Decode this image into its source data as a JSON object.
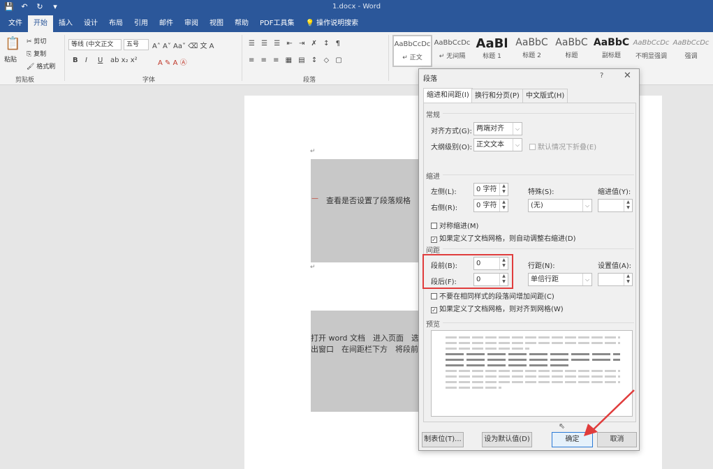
{
  "app": {
    "title": "1.docx - Word"
  },
  "qat": [
    {
      "icon": "save-icon",
      "glyph": "💾"
    },
    {
      "icon": "undo-icon",
      "glyph": "↶"
    },
    {
      "icon": "redo-icon",
      "glyph": "↻"
    },
    {
      "icon": "customize-icon",
      "glyph": "▾"
    }
  ],
  "tabs": [
    "文件",
    "开始",
    "插入",
    "设计",
    "布局",
    "引用",
    "邮件",
    "审阅",
    "视图",
    "帮助",
    "PDF工具集",
    "操作说明搜索"
  ],
  "ribbon": {
    "clipboard": {
      "paste": "粘贴",
      "cut": "剪切",
      "copy": "复制",
      "format_painter": "格式刷",
      "group": "剪贴板"
    },
    "font": {
      "name": "等线 (中文正文",
      "size": "五号",
      "group": "字体"
    },
    "paragraph": {
      "group": "段落"
    },
    "styles": [
      {
        "preview": "AaBbCcDc",
        "name": "↵ 正文"
      },
      {
        "preview": "AaBbCcDc",
        "name": "↵ 无间隔"
      },
      {
        "preview": "AaBl",
        "name": "标题 1"
      },
      {
        "preview": "AaBbC",
        "name": "标题 2"
      },
      {
        "preview": "AaBbC",
        "name": "标题"
      },
      {
        "preview": "AaBbC",
        "name": "副标题"
      },
      {
        "preview": "AaBbCcDc",
        "name": "不明显强调"
      },
      {
        "preview": "AaBbCcDc",
        "name": "强调"
      }
    ]
  },
  "document": {
    "heading": "查看是否设置了段落规格",
    "body_line1": "打开 word 文档　进入页面　选",
    "body_line2": "出窗口　在间距栏下方　将段前"
  },
  "dialog": {
    "title": "段落",
    "help": "?",
    "close": "✕",
    "tabs": [
      "缩进和间距(I)",
      "换行和分页(P)",
      "中文版式(H)"
    ],
    "general": {
      "section": "常规",
      "alignment_label": "对齐方式(G):",
      "alignment_value": "两端对齐",
      "outline_label": "大纲级别(O):",
      "outline_value": "正文文本",
      "collapse_label": "默认情况下折叠(E)"
    },
    "indent": {
      "section": "缩进",
      "left_label": "左侧(L):",
      "left_value": "0 字符",
      "right_label": "右侧(R):",
      "right_value": "0 字符",
      "special_label": "特殊(S):",
      "special_value": "(无)",
      "by_label": "缩进值(Y):",
      "mirror_label": "对称缩进(M)",
      "auto_adjust_label": "如果定义了文档网格，则自动调整右缩进(D)"
    },
    "spacing": {
      "section": "间距",
      "before_label": "段前(B):",
      "before_value": "0",
      "after_label": "段后(F):",
      "after_value": "0",
      "line_label": "行距(N):",
      "line_value": "单倍行距",
      "at_label": "设置值(A):",
      "no_space_label": "不要在相同样式的段落间增加间距(C)",
      "snap_label": "如果定义了文档网格，则对齐到网格(W)"
    },
    "preview": {
      "section": "预览"
    },
    "buttons": {
      "tabs": "制表位(T)...",
      "set_default": "设为默认值(D)",
      "ok": "确定",
      "cancel": "取消"
    }
  },
  "colors": {
    "title_bar": "#2b579a",
    "highlight": "#e03c3c",
    "arrow": "#e03c3c"
  }
}
